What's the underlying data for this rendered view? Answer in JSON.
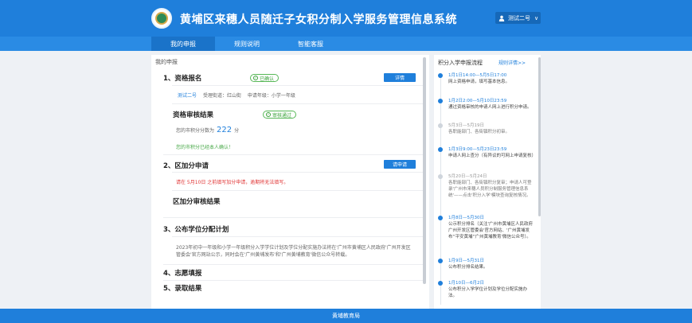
{
  "header": {
    "title": "黄埔区来穗人员随迁子女积分制入学服务管理信息系统",
    "user": "测试二号"
  },
  "nav": [
    {
      "label": "我的申报",
      "active": true
    },
    {
      "label": "规则说明",
      "active": false
    },
    {
      "label": "智能客服",
      "active": false
    }
  ],
  "main": {
    "panel_title": "我的申报",
    "s1": {
      "title": "1、资格报名",
      "status": "已确认",
      "button": "详情",
      "applicant": "测试二号",
      "street": "受理街道：红山街",
      "grade": "申请年级：小学一年级"
    },
    "review": {
      "title": "资格审核结果",
      "status": "审核通过",
      "score_prefix": "您的市积分分数为",
      "score": "222",
      "score_unit": "分",
      "confirmed": "您的市积分已经本人确认！"
    },
    "s2": {
      "title": "2、区加分申请",
      "button": "请申请",
      "notice": "请在 5月10日 之前填写加分申请，逾期将无法填写。",
      "sub_title": "区加分审核结果"
    },
    "s3": {
      "title": "3、公布学位分配计划",
      "para": "2023年初中一年级和小学一年级积分入学学位计划及学位分配实施办法将在'广州市黄埔区人民政府'广州开发区管委会'官方网站公示，同时会在'广州黄埔发布'和'广州黄埔教育'微信公众号转载。"
    },
    "s4": {
      "title": "4、志愿填报"
    },
    "s5": {
      "title": "5、录取结果"
    }
  },
  "side": {
    "title": "积分入学申报流程",
    "link": "规则详情>>",
    "timeline": [
      {
        "date": "1月1日14:00—5月5日17:00",
        "desc": "网上资格申请，填写基本信息。",
        "active": true
      },
      {
        "date": "1月2日2:00—5月10日23:59",
        "desc": "通过资格审核的申请人网上进行积分申请。",
        "active": true
      },
      {
        "date": "5月3日—5月19日",
        "desc": "各职能部门、各街镇积分初审。",
        "active": false
      },
      {
        "date": "1月3日9:00—5月23日23:59",
        "desc": "申请人网上查分（有异议的可网上申请复核）",
        "active": true
      },
      {
        "date": "5月20日—5月24日",
        "desc": "各职能部门、各街镇积分复审；申请人可登录'广州市来穗人员积分制服务管理信息系统'——点击'积分入学'模块查询复核情况。",
        "active": false
      },
      {
        "date": "1月8日—5月30日",
        "desc": "公示积分排名（关注'广州市黄埔区人民政府 广州开发区管委会'官方网站、'广州黄埔发布''平安黄埔''广州黄埔教育'微信公众号）。",
        "active": true
      },
      {
        "date": "1月9日—5月31日",
        "desc": "公布积分排名结果。",
        "active": true
      },
      {
        "date": "1月10日—6月2日",
        "desc": "公布积分入学学位计划及学位分配实施办法。",
        "active": true
      }
    ]
  },
  "footer": {
    "text": "黄埔教育局"
  }
}
